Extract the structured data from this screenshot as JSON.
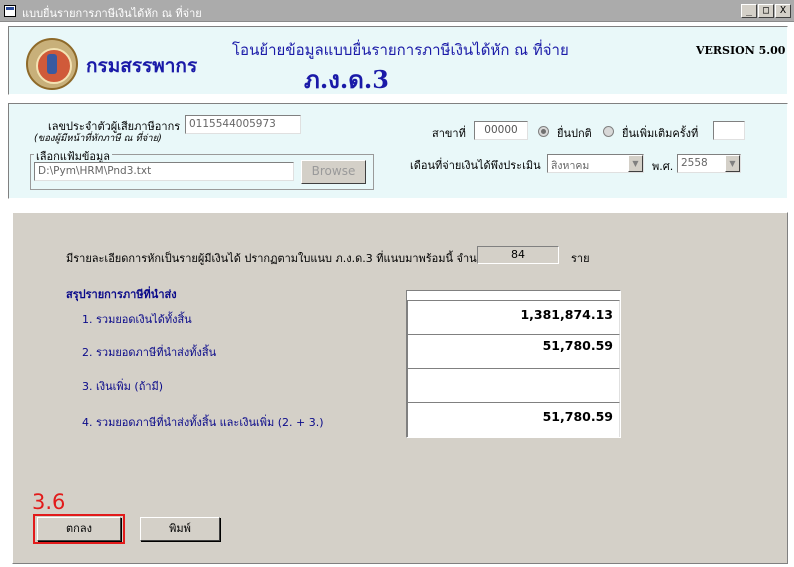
{
  "window": {
    "title": "แบบยื่นรายการภาษีเงินได้หัก ณ ที่จ่าย",
    "controls": {
      "minimize": "_",
      "maximize": "□",
      "close": "X"
    }
  },
  "header": {
    "department": "กรมสรรพากร",
    "title": "โอนย้ายข้อมูลแบบยื่นรายการภาษีเงินได้หัก ณ ที่จ่าย",
    "form_code": "ภ.ง.ด.3",
    "version": "VERSION 5.00"
  },
  "info": {
    "tax_id_label": "เลขประจำตัวผู้เสียภาษีอากร",
    "tax_id_sublabel": "(ของผู้มีหน้าที่หักภาษี ณ ที่จ่าย)",
    "tax_id_value": "0115544005973",
    "file_group_label": "เลือกแฟ้มข้อมูล",
    "file_path": "D:\\Pym\\HRM\\Pnd3.txt",
    "browse_label": "Browse",
    "branch_label": "สาขาที่",
    "branch_value": "00000",
    "radio_normal_label": "ยื่นปกติ",
    "radio_additional_label": "ยื่นเพิ่มเติมครั้งที่",
    "additional_count": "",
    "payment_month_label": "เดือนที่จ่ายเงินได้พึงประเมิน",
    "month_value": "สิงหาคม",
    "year_label": "พ.ศ.",
    "year_value": "2558"
  },
  "summary": {
    "detail_text": "มีรายละเอียดการหักเป็นรายผู้มีเงินได้ ปรากฏตามใบแนบ ภ.ง.ด.3 ที่แนบมาพร้อมนี้ จำนวน :",
    "count_value": "84",
    "count_unit": "ราย",
    "section_title": "สรุปรายการภาษีที่นำส่ง",
    "rows": [
      {
        "label": "1. รวมยอดเงินได้ทั้งสิ้น",
        "value": "1,381,874.13"
      },
      {
        "label": "2. รวมยอดภาษีที่นำส่งทั้งสิ้น",
        "value": "51,780.59"
      },
      {
        "label": "3. เงินเพิ่ม (ถ้ามี)",
        "value": ""
      },
      {
        "label": "4. รวมยอดภาษีที่นำส่งทั้งสิ้น และเงินเพิ่ม (2. + 3.)",
        "value": "51,780.59"
      }
    ]
  },
  "buttons": {
    "ok_label": "ตกลง",
    "print_label": "พิมพ์"
  },
  "annotation": {
    "label": "3.6",
    "color": "#e21b1b"
  }
}
